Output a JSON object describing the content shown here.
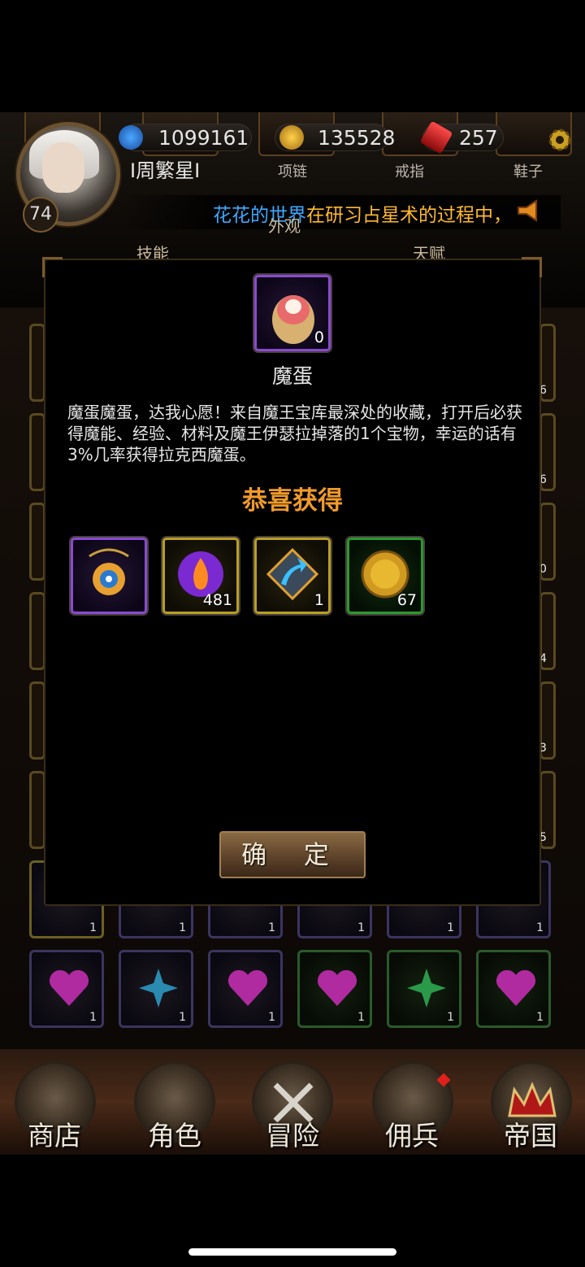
{
  "header": {
    "level": "74",
    "player_name": "I周繁星I",
    "currency_1": "1099161",
    "currency_2": "135528",
    "currency_3": "257",
    "slot_labels": [
      "项链",
      "戒指",
      "鞋子"
    ],
    "tab_labels": [
      "技能",
      "外观",
      "天赋"
    ],
    "ticker_name": "花花的世界",
    "ticker_message": "在研习占星术的过程中，"
  },
  "modal": {
    "item_title": "魔蛋",
    "item_count": "0",
    "description": "魔蛋魔蛋，达我心愿！来自魔王宝库最深处的收藏，打开后必获得魔能、经验、材料及魔王伊瑟拉掉落的1个宝物，幸运的话有3%几率获得拉克西魔蛋。",
    "congrats": "恭喜获得",
    "rewards": [
      {
        "icon": "necklace-icon",
        "count": "",
        "rarity": "purple"
      },
      {
        "icon": "fire-orb-icon",
        "count": "481",
        "rarity": "yellow"
      },
      {
        "icon": "upgrade-arrow-icon",
        "count": "1",
        "rarity": "yellow"
      },
      {
        "icon": "gold-coin-icon",
        "count": "67",
        "rarity": "green"
      }
    ],
    "confirm_label": "确 定"
  },
  "background_grid": {
    "row_counts": [
      "1",
      "1",
      "1",
      "1",
      "1",
      "1"
    ],
    "side_counts": [
      "6",
      "6",
      "0",
      "4",
      "3",
      "5"
    ]
  },
  "nav": {
    "items": [
      "商店",
      "角色",
      "冒险",
      "佣兵",
      "帝国"
    ]
  },
  "colors": {
    "ticker_name": "#3ea8ff",
    "ticker_message": "#ffb830",
    "congrats": "#f09a2a"
  }
}
